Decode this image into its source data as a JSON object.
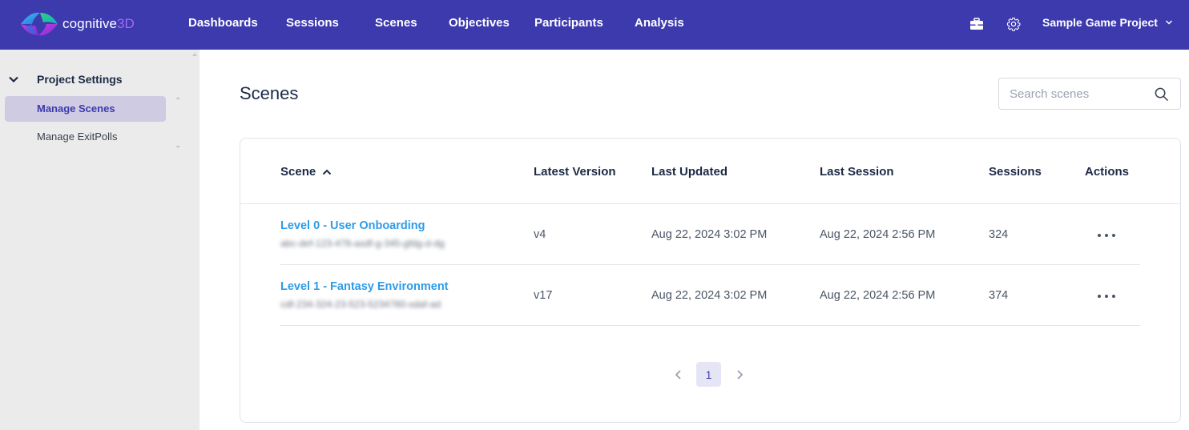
{
  "app": {
    "brand_name": "cognitive",
    "brand_accent": "3D",
    "colors": {
      "nav_bg": "#3d3aae",
      "link": "#2e9be8",
      "active_bg": "#cecbe2",
      "sidebar_bg": "#ebebeb"
    }
  },
  "nav": {
    "items": [
      "Dashboards",
      "Sessions",
      "Scenes",
      "Objectives",
      "Participants",
      "Analysis"
    ],
    "toolbox_icon": "toolbox-icon",
    "settings_icon": "gear-icon",
    "project": "Sample Game Project"
  },
  "sidebar": {
    "section": "Project Settings",
    "items": [
      {
        "label": "Manage Scenes",
        "active": true
      },
      {
        "label": "Manage ExitPolls",
        "active": false
      }
    ]
  },
  "main": {
    "title": "Scenes",
    "search": {
      "placeholder": "Search scenes",
      "value": ""
    },
    "table": {
      "columns": [
        "Scene",
        "Latest Version",
        "Last Updated",
        "Last Session",
        "Sessions",
        "Actions"
      ],
      "sort": {
        "column": "Scene",
        "direction": "ascending"
      },
      "rows": [
        {
          "name": "Level 0 - User Onboarding",
          "id": "abc-def-123-478-asdf-g-345-gfdg-d-dg",
          "version": "v4",
          "last_updated": "Aug 22, 2024 3:02 PM",
          "last_session": "Aug 22, 2024 2:56 PM",
          "sessions": "324"
        },
        {
          "name": "Level 1 - Fantasy Environment",
          "id": "cdf-234-324-23-523-5234780-xdaf-ad",
          "version": "v17",
          "last_updated": "Aug 22, 2024 3:02 PM",
          "last_session": "Aug 22, 2024 2:56 PM",
          "sessions": "374"
        }
      ]
    },
    "pagination": {
      "current_page": "1"
    }
  }
}
